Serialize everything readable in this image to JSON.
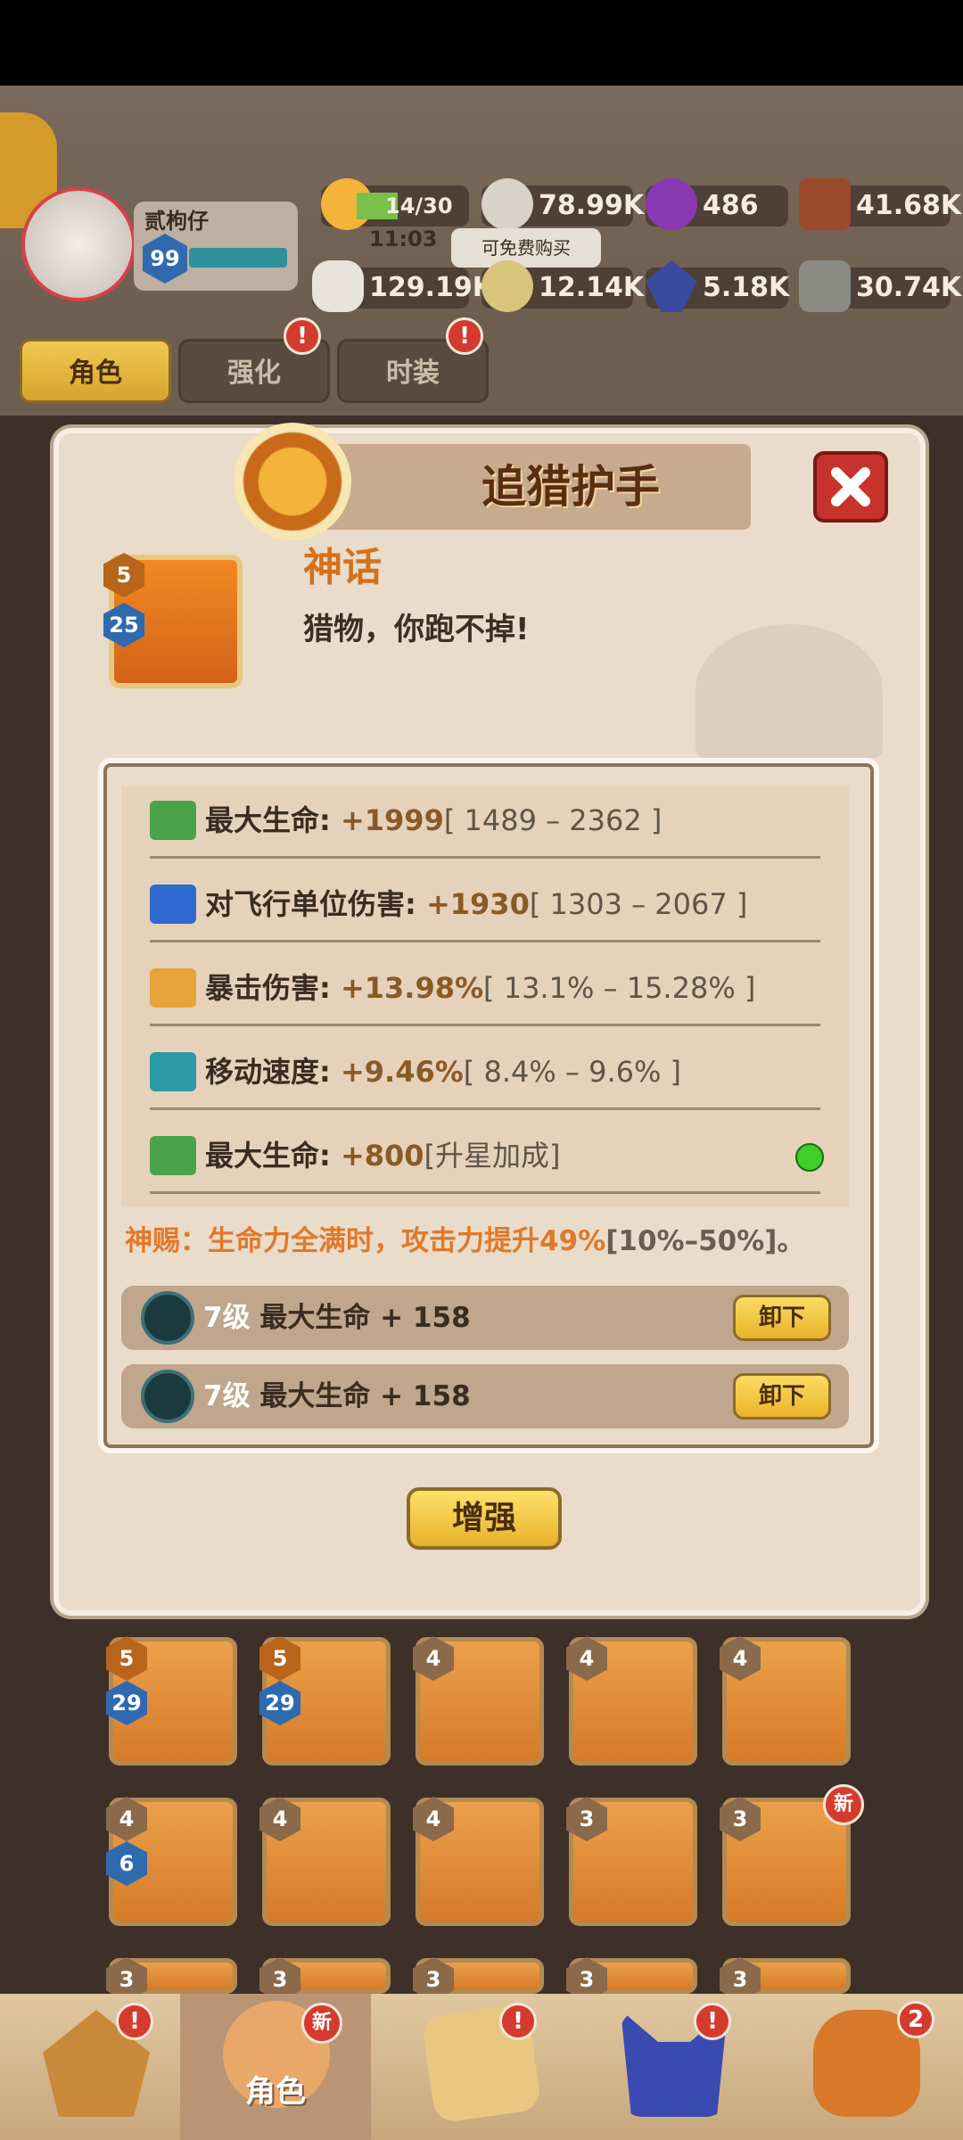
{
  "header": {
    "player_name": "贰枸仔",
    "player_level": "99",
    "stamina": "14/30",
    "stamina_timer": "11:03",
    "free_buy_tip": "可免费购买",
    "resources": [
      {
        "icon": "meat-icon",
        "value": ""
      },
      {
        "icon": "silver-coin-icon",
        "value": "78.99K"
      },
      {
        "icon": "purple-gem-icon",
        "value": "486"
      },
      {
        "icon": "wood-icon",
        "value": "41.68K"
      },
      {
        "icon": "bone-icon",
        "value": "129.19K"
      },
      {
        "icon": "gold-coin-icon",
        "value": "12.14K"
      },
      {
        "icon": "blue-crystal-icon",
        "value": "5.18K"
      },
      {
        "icon": "ore-icon",
        "value": "30.74K"
      }
    ]
  },
  "tabs": [
    {
      "label": "角色",
      "active": true
    },
    {
      "label": "强化",
      "badge": "!"
    },
    {
      "label": "时装",
      "badge": "!"
    }
  ],
  "modal": {
    "title": "追猎护手",
    "rarity": "神话",
    "description": "猎物，你跑不掉!",
    "item_star": "5",
    "item_level": "25",
    "stats": [
      {
        "icon": "heart-icon",
        "name": "最大生命:",
        "value": " +1999",
        "range": "[ 1489 – 2362 ]"
      },
      {
        "icon": "bat-icon",
        "name": "对飞行单位伤害:",
        "value": " +1930",
        "range": "[ 1303 – 2067 ]"
      },
      {
        "icon": "crit-icon",
        "name": "暴击伤害:",
        "value": " +13.98%",
        "range": "[ 13.1% – 15.28% ]"
      },
      {
        "icon": "boot-speed-icon",
        "name": "移动速度:",
        "value": " +9.46%",
        "range": "[ 8.4% – 9.6% ]"
      },
      {
        "icon": "heart-icon",
        "name": "最大生命:",
        "value": " +800",
        "range": "[升星加成]"
      }
    ],
    "divine_text": "神赐：生命力全满时，攻击力提升49%",
    "divine_range": "[10%–50%]。",
    "gems": [
      {
        "level": "7级",
        "text": "最大生命 + 158",
        "button": "卸下"
      },
      {
        "level": "7级",
        "text": "最大生命 + 158",
        "button": "卸下"
      }
    ],
    "enhance_button": "增强"
  },
  "inventory": {
    "row1": [
      {
        "star": "5",
        "level": "29"
      },
      {
        "star": "5",
        "level": "29"
      },
      {
        "star": "4",
        "level": ""
      },
      {
        "star": "4",
        "level": ""
      },
      {
        "star": "4",
        "level": ""
      }
    ],
    "row2": [
      {
        "star": "4",
        "level": "6"
      },
      {
        "star": "4",
        "level": ""
      },
      {
        "star": "4",
        "level": ""
      },
      {
        "star": "3",
        "level": ""
      },
      {
        "star": "3",
        "level": "",
        "new": "新"
      }
    ],
    "row3": [
      {
        "star": "3"
      },
      {
        "star": "3"
      },
      {
        "star": "3"
      },
      {
        "star": "3"
      },
      {
        "star": "3"
      }
    ]
  },
  "bottom_nav": {
    "active_label": "角色",
    "items": [
      {
        "icon": "helmet-icon",
        "badge": "!"
      },
      {
        "icon": "character-icon",
        "badge": "新"
      },
      {
        "icon": "map-icon",
        "badge": "!"
      },
      {
        "icon": "wolf-icon",
        "badge": "!"
      },
      {
        "icon": "bag-icon",
        "badge": "2"
      }
    ]
  }
}
